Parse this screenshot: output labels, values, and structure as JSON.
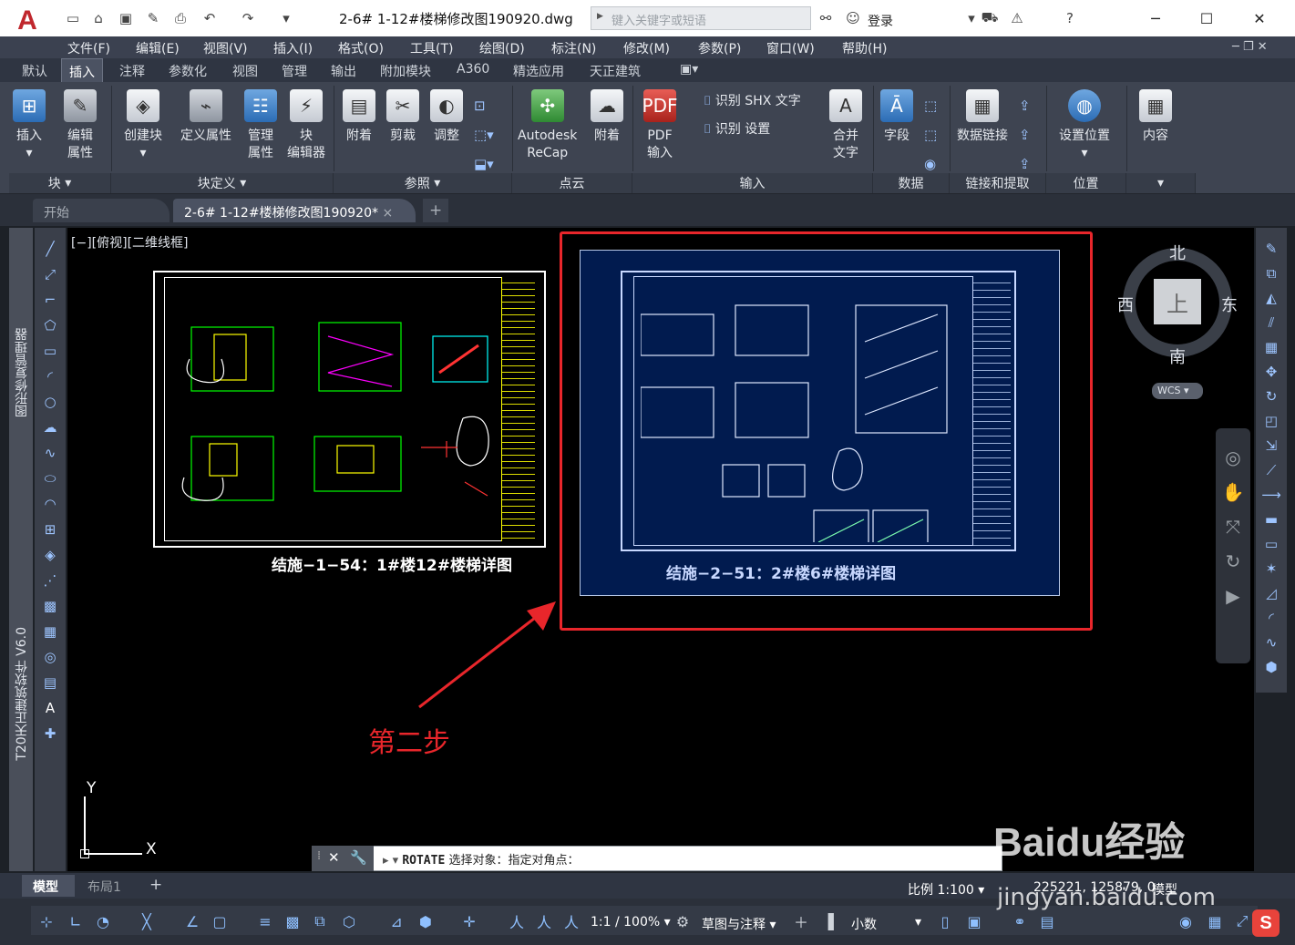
{
  "app": {
    "logo": "A",
    "title": "2-6# 1-12#楼梯修改图190920.dwg",
    "search_placeholder": "键入关键字或短语",
    "login": "登录"
  },
  "menu": [
    "文件(F)",
    "编辑(E)",
    "视图(V)",
    "插入(I)",
    "格式(O)",
    "工具(T)",
    "绘图(D)",
    "标注(N)",
    "修改(M)",
    "参数(P)",
    "窗口(W)",
    "帮助(H)"
  ],
  "ribbon_tabs": [
    "默认",
    "插入",
    "注释",
    "参数化",
    "视图",
    "管理",
    "输出",
    "附加模块",
    "A360",
    "精选应用",
    "天正建筑"
  ],
  "ribbon": {
    "block": {
      "insert": "插入",
      "edit_attr_1": "编辑",
      "edit_attr_2": "属性",
      "panel": "块"
    },
    "blockdef": {
      "create": "创建块",
      "define_attr": "定义属性",
      "manage_attr_1": "管理",
      "manage_attr_2": "属性",
      "block_editor_1": "块",
      "block_editor_2": "编辑器",
      "panel": "块定义"
    },
    "reference": {
      "attach": "附着",
      "clip": "剪裁",
      "adjust": "调整",
      "panel": "参照"
    },
    "pointcloud": {
      "recap_1": "Autodesk",
      "recap_2": "ReCap",
      "attach": "附着",
      "panel": "点云"
    },
    "import": {
      "pdf_1": "PDF",
      "pdf_2": "输入",
      "shx": "识别 SHX 文字",
      "settings": "识别 设置",
      "merge_1": "合并",
      "merge_2": "文字",
      "panel": "输入"
    },
    "data": {
      "field": "字段",
      "panel": "数据"
    },
    "linking": {
      "data_link": "数据链接",
      "panel": "链接和提取"
    },
    "location": {
      "set": "设置位置",
      "panel": "位置"
    },
    "content": {
      "label": "内容"
    }
  },
  "doc_tabs": {
    "start": "开始",
    "active": "2-6# 1-12#楼梯修改图190920*"
  },
  "viewport": {
    "label": "[−][俯视][二维线框]"
  },
  "palette": {
    "title": "图形修复管理器"
  },
  "tianzheng": {
    "title": "T20天正建筑软件 V6.0"
  },
  "drawing": {
    "left_caption": "结施−1−54：1#楼12#楼梯详图",
    "right_caption": "结施−2−51：2#楼6#楼梯详图",
    "annotation": "第二步",
    "annotation_color": "#e8262b"
  },
  "viewcube": {
    "north": "北",
    "south": "南",
    "east": "东",
    "west": "西",
    "top": "上",
    "wcs": "WCS"
  },
  "ucs": {
    "x": "X",
    "y": "Y"
  },
  "command": {
    "name": "ROTATE",
    "text": "选择对象：指定对角点："
  },
  "layout_tabs": {
    "model": "模型",
    "layout1": "布局1"
  },
  "status": {
    "scale": "比例 1:100",
    "coords": "225221, 125879, 0",
    "model": "模型",
    "annotation_scale": "1:1 / 100%",
    "workspace": "草图与注释",
    "units": "小数"
  },
  "watermark": {
    "text": "Baidu经验",
    "url": "jingyan.baidu.com"
  }
}
